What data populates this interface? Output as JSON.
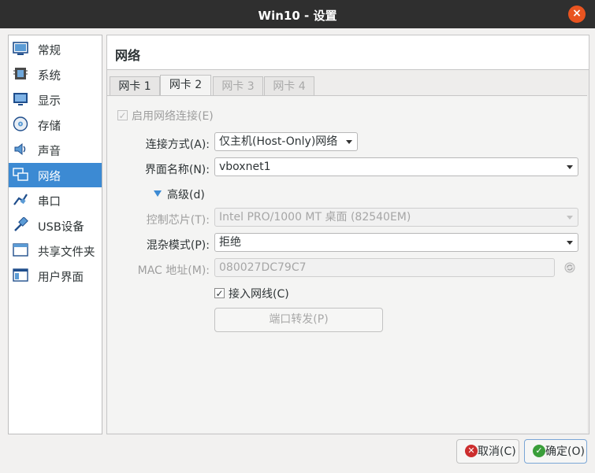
{
  "window": {
    "title": "Win10 - 设置",
    "close_glyph": "×"
  },
  "sidebar": {
    "items": [
      {
        "label": "常规",
        "icon": "general-icon"
      },
      {
        "label": "系统",
        "icon": "system-icon"
      },
      {
        "label": "显示",
        "icon": "display-icon"
      },
      {
        "label": "存储",
        "icon": "storage-icon"
      },
      {
        "label": "声音",
        "icon": "audio-icon"
      },
      {
        "label": "网络",
        "icon": "network-icon",
        "active": true
      },
      {
        "label": "串口",
        "icon": "serial-port-icon"
      },
      {
        "label": "USB设备",
        "icon": "usb-icon"
      },
      {
        "label": "共享文件夹",
        "icon": "shared-folder-icon"
      },
      {
        "label": "用户界面",
        "icon": "user-interface-icon"
      }
    ]
  },
  "page": {
    "title": "网络"
  },
  "tabs": [
    {
      "label": "网卡 1",
      "state": "normal"
    },
    {
      "label": "网卡 2",
      "state": "active"
    },
    {
      "label": "网卡 3",
      "state": "disabled"
    },
    {
      "label": "网卡 4",
      "state": "disabled"
    }
  ],
  "form": {
    "enable_adapter": {
      "label": "启用网络连接(E)",
      "checked": true,
      "disabled": true,
      "check_glyph": "✓"
    },
    "attached_to": {
      "label": "连接方式(A):",
      "value": "仅主机(Host-Only)网络"
    },
    "name": {
      "label": "界面名称(N):",
      "value": "vboxnet1"
    },
    "advanced": {
      "label": "高级(d)",
      "expanded": true
    },
    "adapter_type": {
      "label": "控制芯片(T):",
      "value": "Intel PRO/1000 MT 桌面 (82540EM)",
      "disabled": true
    },
    "promiscuous": {
      "label": "混杂模式(P):",
      "value": "拒绝"
    },
    "mac": {
      "label": "MAC 地址(M):",
      "value": "080027DC79C7",
      "disabled": true
    },
    "cable_connected": {
      "label": "接入网线(C)",
      "checked": true,
      "check_glyph": "✓"
    },
    "port_forwarding": {
      "label": "端口转发(P)",
      "disabled": true
    }
  },
  "footer": {
    "cancel": {
      "label": "取消(C)",
      "glyph": "✕"
    },
    "ok": {
      "label": "确定(O)",
      "glyph": "✓"
    }
  },
  "colors": {
    "accent": "#3c8ad3",
    "titlebar": "#2f2f2f",
    "close": "#e95420"
  }
}
